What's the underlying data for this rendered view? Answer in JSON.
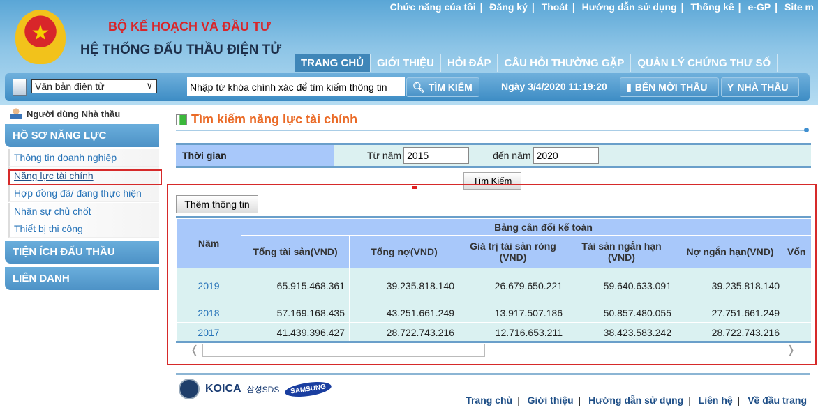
{
  "header": {
    "ministry": "BỘ KẾ HOẠCH VÀ ĐẦU TƯ",
    "system": "HỆ THỐNG ĐẤU THẦU ĐIỆN TỬ",
    "top_links": [
      "Chức năng của tôi",
      "Đăng ký",
      "Thoát",
      "Hướng dẫn sử dụng",
      "Thống kê",
      "e-GP",
      "Site m"
    ],
    "nav": [
      "TRANG CHỦ",
      "GIỚI THIỆU",
      "HỎI ĐÁP",
      "CÂU HỎI THƯỜNG GẶP",
      "QUẢN LÝ CHỨNG THƯ SỐ"
    ],
    "active_nav": "TRANG CHỦ"
  },
  "searchbar": {
    "select_value": "Văn bản điện tử",
    "search_value": "Nhập từ khóa chính xác để tìm kiếm thông tin",
    "search_button": "TÌM KIẾM",
    "date": "Ngày 3/4/2020 11:19:20",
    "btn_bid": "BẾN MỜI THẦU",
    "btn_contractor": "NHÀ THẦU"
  },
  "sidebar": {
    "user": "Người dùng Nhà thầu",
    "section1": "HỒ SƠ NĂNG LỰC",
    "items": [
      "Thông tin doanh nghiệp",
      "Năng lực tài chính",
      "Hợp đồng đã/ đang thực hiện",
      "Nhân sự chủ chốt",
      "Thiết bị thi công"
    ],
    "section2": "TIỆN ÍCH ĐẤU THẦU",
    "section3": "LIÊN DANH"
  },
  "main": {
    "title": "Tìm kiếm năng lực tài chính",
    "filter": {
      "label": "Thời gian",
      "from_label": "Từ năm",
      "from_value": "2015",
      "to_label": "đến năm",
      "to_value": "2020"
    },
    "search_button": "Tìm Kiếm",
    "add_button": "Thêm thông tin",
    "table": {
      "year_header": "Năm",
      "group_header": "Bảng cân đối kế toán",
      "columns": [
        "Tổng tài sản(VND)",
        "Tổng nợ(VND)",
        "Giá trị tài sản ròng (VND)",
        "Tài sản ngắn hạn (VND)",
        "Nợ ngắn hạn(VND)",
        "Vốn"
      ],
      "rows": [
        {
          "year": "2019",
          "values": [
            "65.915.468.361",
            "39.235.818.140",
            "26.679.650.221",
            "59.640.633.091",
            "39.235.818.140",
            ""
          ]
        },
        {
          "year": "2018",
          "values": [
            "57.169.168.435",
            "43.251.661.249",
            "13.917.507.186",
            "50.857.480.055",
            "27.751.661.249",
            ""
          ]
        },
        {
          "year": "2017",
          "values": [
            "41.439.396.427",
            "28.722.743.216",
            "12.716.653.211",
            "38.423.583.242",
            "28.722.743.216",
            ""
          ]
        }
      ]
    }
  },
  "footer": {
    "logos": {
      "koica": "KOICA",
      "sds": "삼성SDS",
      "samsung": "SAMSUNG"
    },
    "links": [
      "Trang chủ",
      "Giới thiệu",
      "Hướng dẫn sử dụng",
      "Liên hệ",
      "Về đầu trang"
    ]
  },
  "colors": {
    "accent": "#ea6a26",
    "header_blue": "#4d92c6",
    "highlight": "#d62a2a"
  }
}
